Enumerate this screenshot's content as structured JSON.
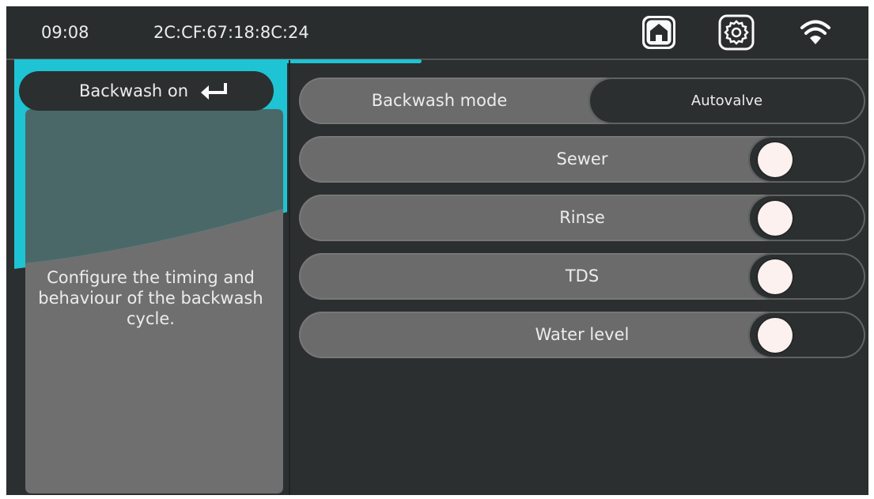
{
  "statusbar": {
    "time": "09:08",
    "mac": "2C:CF:67:18:8C:24",
    "icons": [
      "home-icon",
      "gear-icon",
      "wifi-icon"
    ]
  },
  "leftpanel": {
    "back_label": "Backwash on",
    "back_icon": "return-arrow-icon",
    "description": "Configure the timing and behaviour of the backwash cycle."
  },
  "rows": {
    "mode": {
      "label": "Backwash mode",
      "value": "Autovalve"
    },
    "toggles": [
      {
        "label": "Sewer",
        "state": "off"
      },
      {
        "label": "Rinse",
        "state": "off"
      },
      {
        "label": "TDS",
        "state": "off"
      },
      {
        "label": "Water level",
        "state": "off"
      }
    ]
  },
  "colors": {
    "background": "#2b2f30",
    "accent": "#1ec4d3",
    "row": "#6b6b6b",
    "panel": "#6f6f6f",
    "text": "#ececec"
  }
}
